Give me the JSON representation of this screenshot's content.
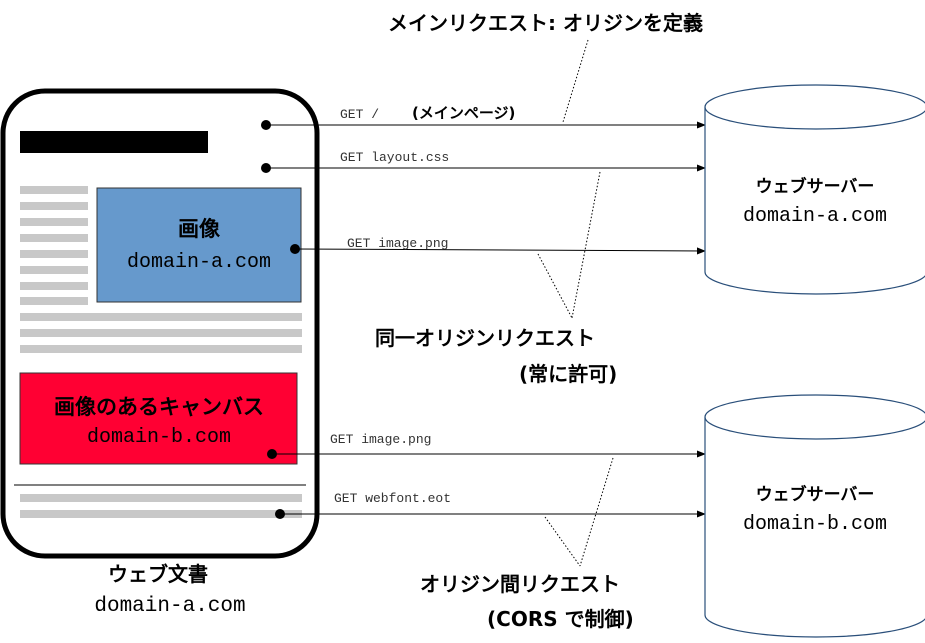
{
  "titles": {
    "main_request": "メインリクエスト: オリジンを定義",
    "same_origin_line1": "同一オリジンリクエスト",
    "same_origin_line2": "(常に許可)",
    "cross_origin_line1": "オリジン間リクエスト",
    "cross_origin_line2": "(CORS で制御)"
  },
  "document": {
    "label": "ウェブ文書",
    "domain": "domain-a.com"
  },
  "image_box": {
    "label": "画像",
    "domain": "domain-a.com",
    "color": "#6699cc"
  },
  "canvas_box": {
    "label": "画像のあるキャンバス",
    "domain": "domain-b.com",
    "color": "#ff0033"
  },
  "servers": [
    {
      "label": "ウェブサーバー",
      "domain": "domain-a.com"
    },
    {
      "label": "ウェブサーバー",
      "domain": "domain-b.com"
    }
  ],
  "requests": [
    {
      "method": "GET /",
      "note": "(メインページ)"
    },
    {
      "method": "GET layout.css"
    },
    {
      "method": "GET image.png"
    },
    {
      "method": "GET image.png"
    },
    {
      "method": "GET webfont.eot"
    }
  ]
}
